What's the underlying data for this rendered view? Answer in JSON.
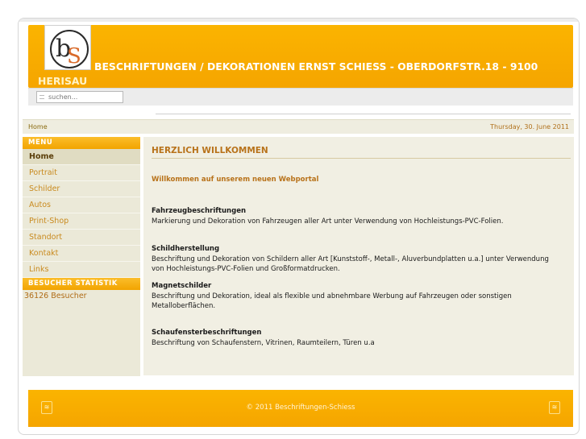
{
  "header": {
    "title": "BESCHRIFTUNGEN / DEKORATIONEN ERNST SCHIESS - OBERDORFSTR.18 - 9100",
    "title_cont": "HERISAU"
  },
  "search": {
    "placeholder": "suchen..."
  },
  "breadcrumb": {
    "home": "Home",
    "date": "Thursday, 30. June 2011"
  },
  "sidebar": {
    "menu_title": "MENU",
    "items": [
      {
        "label": "Home",
        "active": true
      },
      {
        "label": "Portrait"
      },
      {
        "label": "Schilder"
      },
      {
        "label": "Autos"
      },
      {
        "label": "Print-Shop"
      },
      {
        "label": "Standort"
      },
      {
        "label": "Kontakt"
      },
      {
        "label": "Links"
      }
    ],
    "stats_title": "BESUCHER STATISTIK",
    "visitors": "36126 Besucher"
  },
  "content": {
    "title": "HERZLICH WILLKOMMEN",
    "welcome": "Willkommen auf unserem neuen Webportal",
    "sections": [
      {
        "title": "Fahrzeugbeschriftungen",
        "text": "Markierung und Dekoration von Fahrzeugen aller Art unter Verwendung von Hochleistungs-PVC-Folien."
      },
      {
        "title": "Schildherstellung",
        "text": "Beschriftung und Dekoration von Schildern aller Art [Kunststoff-, Metall-, Aluverbundplatten u.a.] unter Verwendung von Hochleistungs-PVC-Folien und Großformatdrucken."
      },
      {
        "title": "Magnetschilder",
        "text": "Beschriftung und Dekoration, ideal als flexible und abnehmbare Werbung auf Fahrzeugen oder sonstigen Metalloberflächen."
      },
      {
        "title": "Schaufensterbeschriftungen",
        "text": "Beschriftung von Schaufenstern, Vitrinen, Raumteilern, Türen u.a"
      }
    ]
  },
  "footer": {
    "copyright": "© 2011 Beschriftungen-Schiess",
    "up_icon": "≋"
  },
  "colors": {
    "accent": "#f5a500",
    "link": "#c98a1e",
    "content_bg": "#f1efe3"
  }
}
